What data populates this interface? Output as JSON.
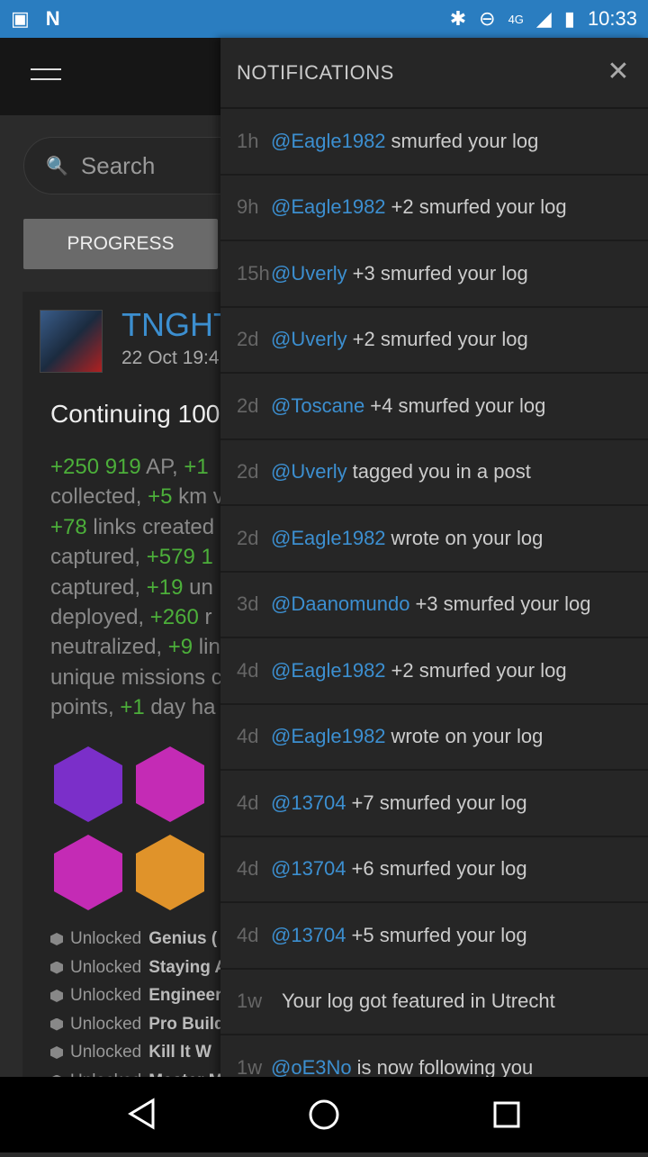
{
  "status_bar": {
    "time": "10:33",
    "network": "4G"
  },
  "search": {
    "placeholder": "Search"
  },
  "progress_label": "PROGRESS",
  "post": {
    "username": "TNGHT",
    "date": "22 Oct 19:4",
    "title": "Continuing 100",
    "stats": [
      [
        "+250 919",
        " AP, ",
        "+1"
      ],
      [
        "",
        "collected, ",
        "+5",
        " km v"
      ],
      [
        "+78",
        " links created"
      ],
      [
        "",
        "captured, ",
        "+579 1"
      ],
      [
        "",
        "captured, ",
        "+19",
        " un"
      ],
      [
        "",
        "deployed, ",
        "+260",
        " r"
      ],
      [
        "",
        "neutralized, ",
        "+9",
        " lin"
      ],
      [
        "",
        "unique missions c"
      ],
      [
        "",
        "points, ",
        "+1",
        " day ha"
      ]
    ],
    "badges": [
      {
        "color": "#7b2fc9"
      },
      {
        "color": "#c42bb5"
      },
      {
        "color": "#c42bb5"
      },
      {
        "color": "#e0932a"
      }
    ],
    "unlocked_prefix": "Unlocked",
    "unlocked": [
      "Genius (",
      "Staying A",
      "Engineer",
      "Pro Build",
      "Kill It W",
      "Master M"
    ]
  },
  "notifications": {
    "title": "NOTIFICATIONS",
    "items": [
      {
        "time": "1h",
        "user": "@Eagle1982",
        "text": "smurfed your log"
      },
      {
        "time": "9h",
        "user": "@Eagle1982",
        "text": "+2 smurfed your log"
      },
      {
        "time": "15h",
        "user": "@Uverly",
        "text": "+3 smurfed your log"
      },
      {
        "time": "2d",
        "user": "@Uverly",
        "text": "+2 smurfed your log"
      },
      {
        "time": "2d",
        "user": "@Toscane",
        "text": "+4 smurfed your log"
      },
      {
        "time": "2d",
        "user": "@Uverly",
        "text": "tagged you in a post"
      },
      {
        "time": "2d",
        "user": "@Eagle1982",
        "text": "wrote on your log"
      },
      {
        "time": "3d",
        "user": "@Daanomundo",
        "text": "+3 smurfed your log"
      },
      {
        "time": "4d",
        "user": "@Eagle1982",
        "text": "+2 smurfed your log"
      },
      {
        "time": "4d",
        "user": "@Eagle1982",
        "text": "wrote on your log"
      },
      {
        "time": "4d",
        "user": "@13704",
        "text": "+7 smurfed your log"
      },
      {
        "time": "4d",
        "user": "@13704",
        "text": "+6 smurfed your log"
      },
      {
        "time": "4d",
        "user": "@13704",
        "text": "+5 smurfed your log"
      },
      {
        "time": "1w",
        "user": "",
        "text": "Your log got featured in Utrecht"
      },
      {
        "time": "1w",
        "user": "@oE3No",
        "text": "is now following you"
      }
    ]
  }
}
